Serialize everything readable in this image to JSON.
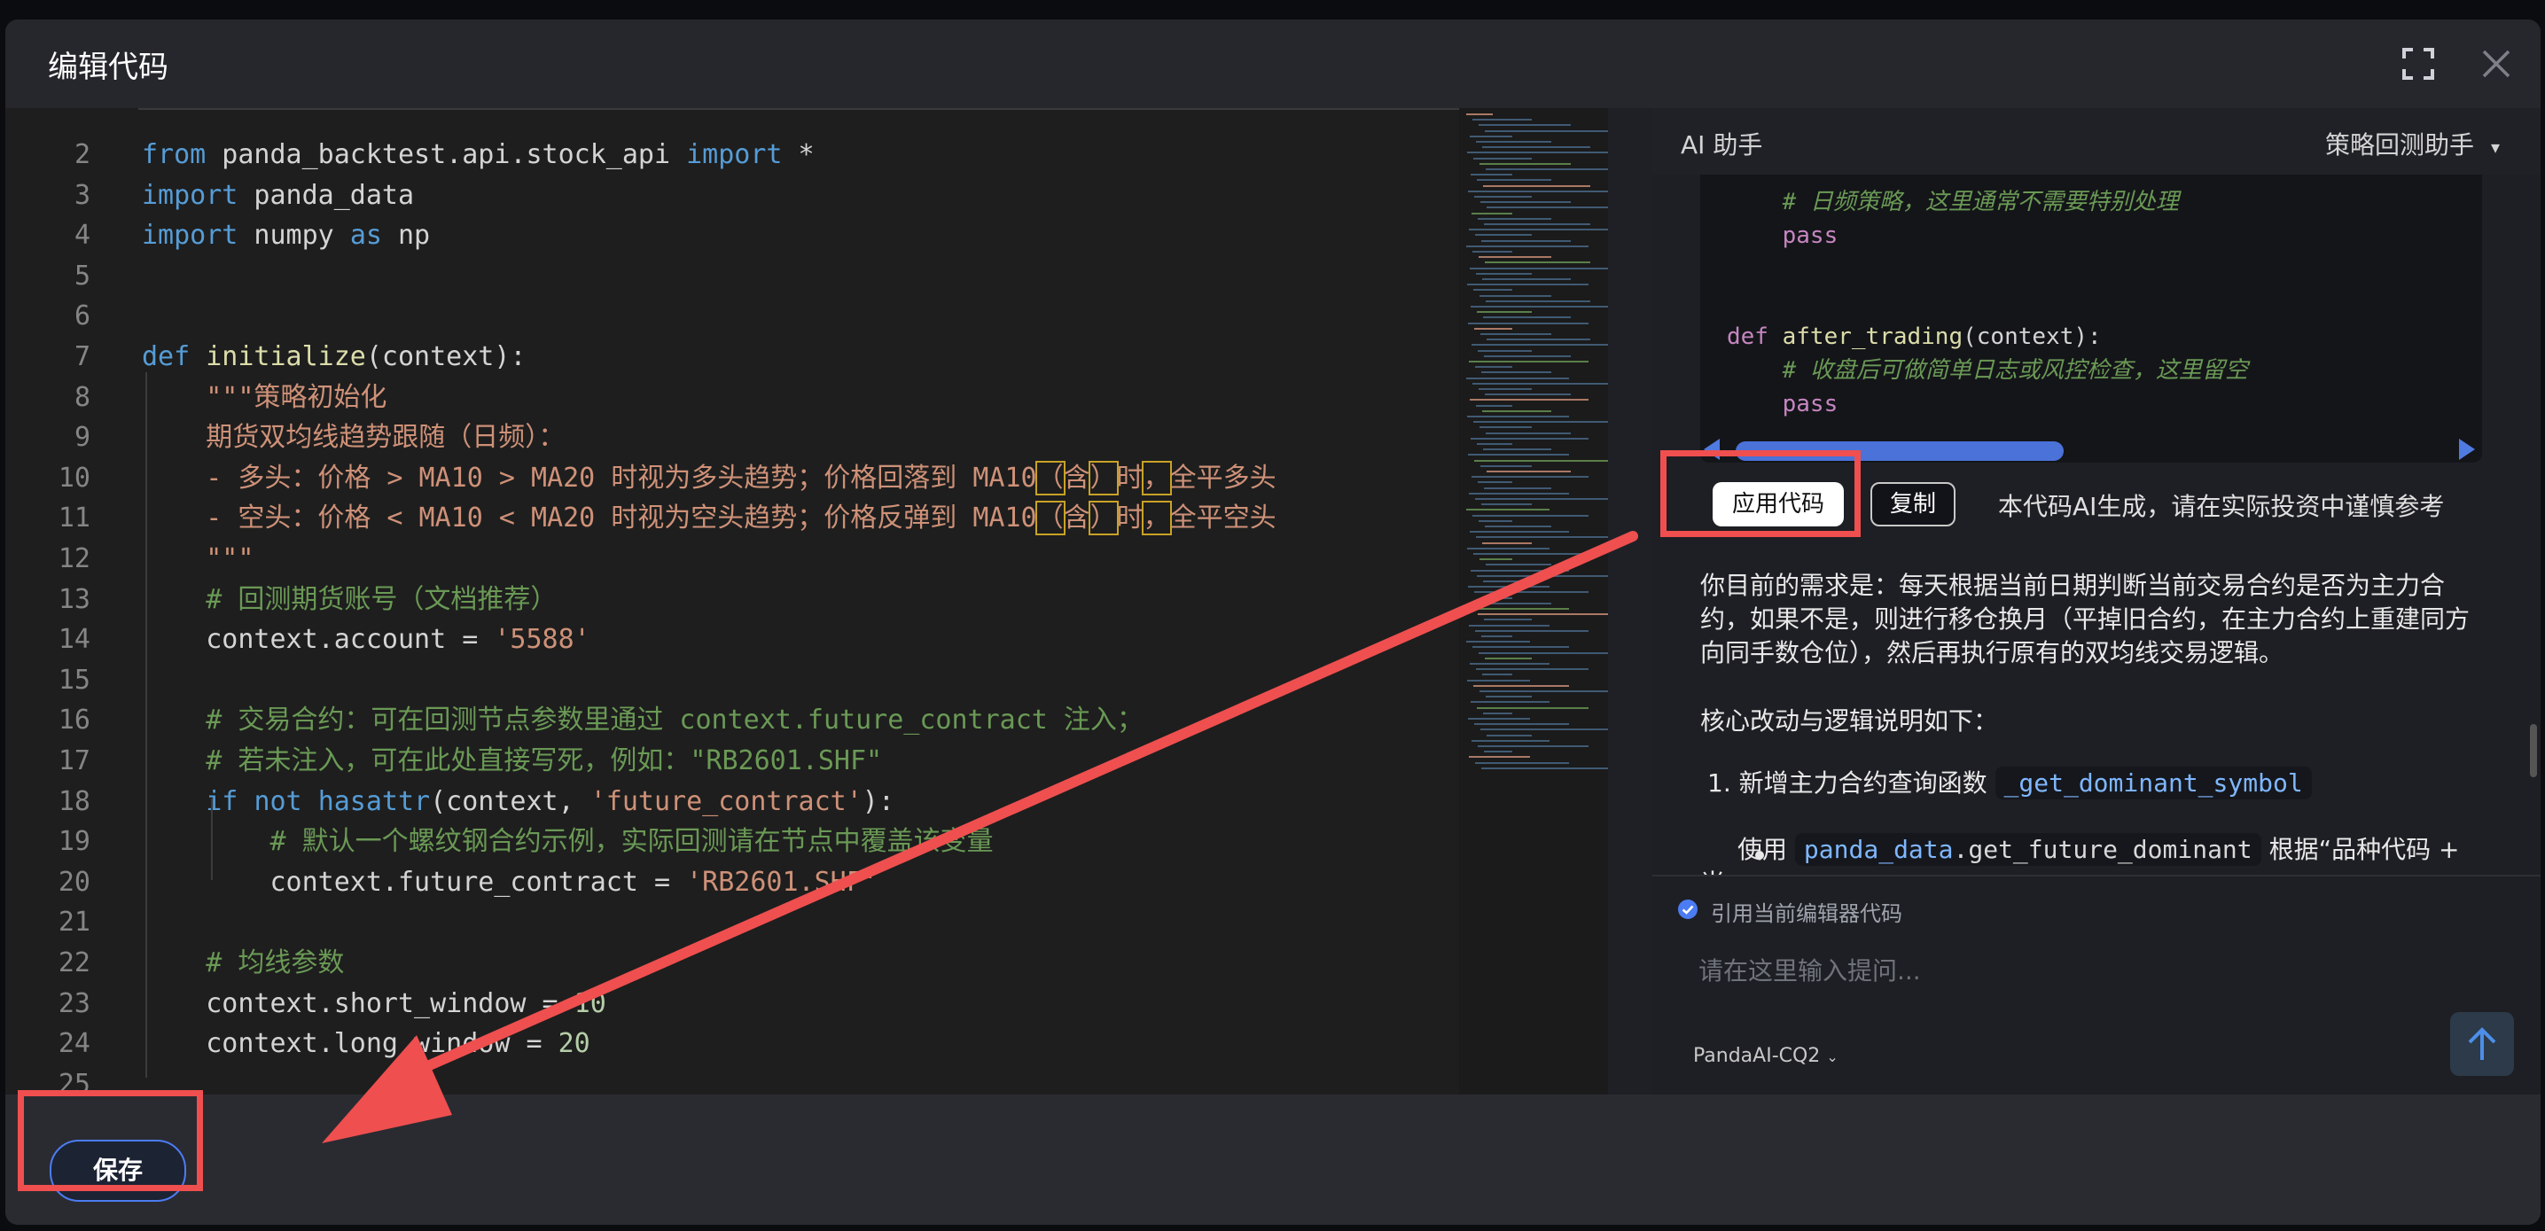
{
  "dialog": {
    "title": "编辑代码"
  },
  "editor": {
    "lines": [
      {
        "n": "2",
        "segments": [
          {
            "t": "from",
            "c": "kw"
          },
          {
            "t": " panda_backtest.api.stock_api ",
            "c": ""
          },
          {
            "t": "import",
            "c": "kw"
          },
          {
            "t": " *",
            "c": ""
          }
        ]
      },
      {
        "n": "3",
        "segments": [
          {
            "t": "import",
            "c": "kw"
          },
          {
            "t": " panda_data",
            "c": ""
          }
        ]
      },
      {
        "n": "4",
        "segments": [
          {
            "t": "import",
            "c": "kw"
          },
          {
            "t": " numpy ",
            "c": ""
          },
          {
            "t": "as",
            "c": "kw"
          },
          {
            "t": " np",
            "c": ""
          }
        ]
      },
      {
        "n": "5",
        "segments": []
      },
      {
        "n": "6",
        "segments": []
      },
      {
        "n": "7",
        "segments": [
          {
            "t": "def",
            "c": "kw"
          },
          {
            "t": " ",
            "c": ""
          },
          {
            "t": "initialize",
            "c": "fn"
          },
          {
            "t": "(context):",
            "c": ""
          }
        ]
      },
      {
        "n": "8",
        "segments": [
          {
            "t": "    \"\"\"策略初始化",
            "c": "str"
          }
        ]
      },
      {
        "n": "9",
        "segments": [
          {
            "t": "    期货双均线趋势跟随（日频）：",
            "c": "str"
          }
        ]
      },
      {
        "n": "10",
        "segments": [
          {
            "t": "    - 多头：价格 > MA10 > MA20 时视为多头趋势；价格回落到 MA10",
            "c": "str"
          },
          {
            "t": "（",
            "c": "str hl"
          },
          {
            "t": "含",
            "c": "str"
          },
          {
            "t": "）",
            "c": "str hl"
          },
          {
            "t": "时",
            "c": "str"
          },
          {
            "t": "，",
            "c": "str hl"
          },
          {
            "t": "全平多头",
            "c": "str"
          }
        ]
      },
      {
        "n": "11",
        "segments": [
          {
            "t": "    - 空头：价格 < MA10 < MA20 时视为空头趋势；价格反弹到 MA10",
            "c": "str"
          },
          {
            "t": "（",
            "c": "str hl"
          },
          {
            "t": "含",
            "c": "str"
          },
          {
            "t": "）",
            "c": "str hl"
          },
          {
            "t": "时",
            "c": "str"
          },
          {
            "t": "，",
            "c": "str hl"
          },
          {
            "t": "全平空头",
            "c": "str"
          }
        ]
      },
      {
        "n": "12",
        "segments": [
          {
            "t": "    \"\"\"",
            "c": "str"
          }
        ]
      },
      {
        "n": "13",
        "segments": [
          {
            "t": "    # 回测期货账号（文档推荐）",
            "c": "cmt"
          }
        ]
      },
      {
        "n": "14",
        "segments": [
          {
            "t": "    context.account = ",
            "c": ""
          },
          {
            "t": "'5588'",
            "c": "str"
          }
        ]
      },
      {
        "n": "15",
        "segments": []
      },
      {
        "n": "16",
        "segments": [
          {
            "t": "    # 交易合约：可在回测节点参数里通过 context.future_contract 注入；",
            "c": "cmt"
          }
        ]
      },
      {
        "n": "17",
        "segments": [
          {
            "t": "    # 若未注入，可在此处直接写死，例如：\"RB2601.SHF\"",
            "c": "cmt"
          }
        ]
      },
      {
        "n": "18",
        "segments": [
          {
            "t": "    ",
            "c": ""
          },
          {
            "t": "if",
            "c": "kw"
          },
          {
            "t": " ",
            "c": ""
          },
          {
            "t": "not",
            "c": "kw"
          },
          {
            "t": " ",
            "c": ""
          },
          {
            "t": "hasattr",
            "c": "kw"
          },
          {
            "t": "(context, ",
            "c": ""
          },
          {
            "t": "'future_contract'",
            "c": "str"
          },
          {
            "t": "):",
            "c": ""
          }
        ]
      },
      {
        "n": "19",
        "segments": [
          {
            "t": "        # 默认一个螺纹钢合约示例，实际回测请在节点中覆盖该变量",
            "c": "cmt"
          }
        ]
      },
      {
        "n": "20",
        "segments": [
          {
            "t": "        context.future_contract = ",
            "c": ""
          },
          {
            "t": "'RB2601.SHF'",
            "c": "str"
          }
        ]
      },
      {
        "n": "21",
        "segments": []
      },
      {
        "n": "22",
        "segments": [
          {
            "t": "    # 均线参数",
            "c": "cmt"
          }
        ]
      },
      {
        "n": "23",
        "segments": [
          {
            "t": "    context.short_window = ",
            "c": ""
          },
          {
            "t": "10",
            "c": "num"
          }
        ]
      },
      {
        "n": "24",
        "segments": [
          {
            "t": "    context.long_window = ",
            "c": ""
          },
          {
            "t": "20",
            "c": "num"
          }
        ]
      },
      {
        "n": "25",
        "segments": []
      }
    ]
  },
  "footer": {
    "save_label": "保存"
  },
  "assistant": {
    "title": "AI 助手",
    "mode": "策略回测助手",
    "code_block": [
      {
        "segments": [
          {
            "t": "    # 日频策略，这里通常不需要特别处理",
            "c": "cb-cmt"
          }
        ]
      },
      {
        "segments": [
          {
            "t": "    ",
            "c": ""
          },
          {
            "t": "pass",
            "c": "cb-pass"
          }
        ]
      },
      {
        "segments": []
      },
      {
        "segments": []
      },
      {
        "segments": [
          {
            "t": "def",
            "c": "cb-kw"
          },
          {
            "t": " ",
            "c": ""
          },
          {
            "t": "after_trading",
            "c": "cb-fn"
          },
          {
            "t": "(context):",
            "c": ""
          }
        ]
      },
      {
        "segments": [
          {
            "t": "    # 收盘后可做简单日志或风控检查，这里留空",
            "c": "cb-cmt"
          }
        ]
      },
      {
        "segments": [
          {
            "t": "    ",
            "c": ""
          },
          {
            "t": "pass",
            "c": "cb-pass"
          }
        ]
      }
    ],
    "apply_label": "应用代码",
    "copy_label": "复制",
    "disclaimer": "本代码AI生成，请在实际投资中谨慎参考",
    "message_p1": "你目前的需求是：每天根据当前日期判断当前交易合约是否为主力合约，如果不是，则进行移仓换月（平掉旧合约，在主力合约上重建同方向同手数仓位），然后再执行原有的双均线交易逻辑。",
    "message_p2": "核心改动与逻辑说明如下：",
    "list_item_1_prefix": "1. 新增主力合约查询函数",
    "list_item_1_code": "_get_dominant_symbol",
    "bullet_1_prefix": "使用",
    "bullet_1_code_a": "panda_data",
    "bullet_1_code_b": ".get_future_dominant",
    "bullet_1_suffix": "根据“品种代码 + 当",
    "ref_label": "引用当前编辑器代码",
    "input_placeholder": "请在这里输入提问...",
    "model": "PandaAI-CQ2"
  },
  "colors": {
    "accent": "#4c7cf3",
    "annotation": "#ef4f4f"
  }
}
